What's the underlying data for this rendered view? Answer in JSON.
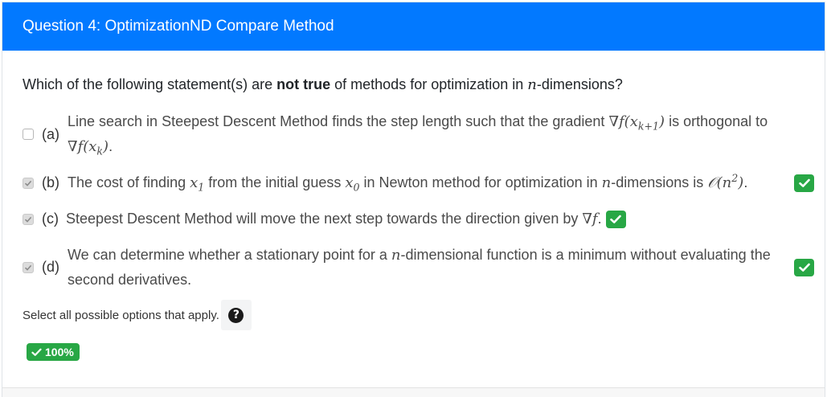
{
  "header": {
    "title": "Question 4: OptimizationND Compare Method"
  },
  "question": {
    "prefix": "Which of the following statement(s) are ",
    "emphasis": "not true",
    "middle": " of methods for optimization in ",
    "n": "n",
    "suffix": "-dimensions?"
  },
  "options": [
    {
      "letter": "(a)",
      "checked": false,
      "correct_badge": false,
      "text_1": "Line search in Steepest Descent Method finds the step length such that the gradient ",
      "math_1": "∇f(x",
      "math_1_sub": "k+1",
      "math_1_end": ")",
      "text_2": " is orthogonal to ",
      "math_2": "∇f(x",
      "math_2_sub": "k",
      "math_2_end": ")",
      "text_3": "."
    },
    {
      "letter": "(b)",
      "checked": true,
      "correct_badge": true,
      "text_1": "The cost of finding ",
      "x1": "x",
      "x1_sub": "1",
      "text_2": " from the initial guess ",
      "x0": "x",
      "x0_sub": "0",
      "text_3": " in Newton method for optimization in ",
      "n": "n",
      "text_4": "-dimensions is ",
      "big_o": "𝒪(n",
      "big_o_sup": "2",
      "big_o_end": ")",
      "text_5": "."
    },
    {
      "letter": "(c)",
      "checked": true,
      "correct_badge": true,
      "text_1": "Steepest Descent Method will move the next step towards the direction given by ",
      "math": "∇f",
      "text_2": "."
    },
    {
      "letter": "(d)",
      "checked": true,
      "correct_badge": true,
      "text_1": "We can determine whether a stationary point for a ",
      "n": "n",
      "text_2": "-dimensional function is a minimum without evaluating the second derivatives."
    }
  ],
  "hint": {
    "text": "Select all possible options that apply.",
    "help_icon": "question-circle-icon",
    "help_glyph": "?"
  },
  "score": {
    "label": "100%",
    "icon": "check-icon"
  },
  "colors": {
    "header_bg": "#0279ff",
    "success": "#28a745"
  }
}
